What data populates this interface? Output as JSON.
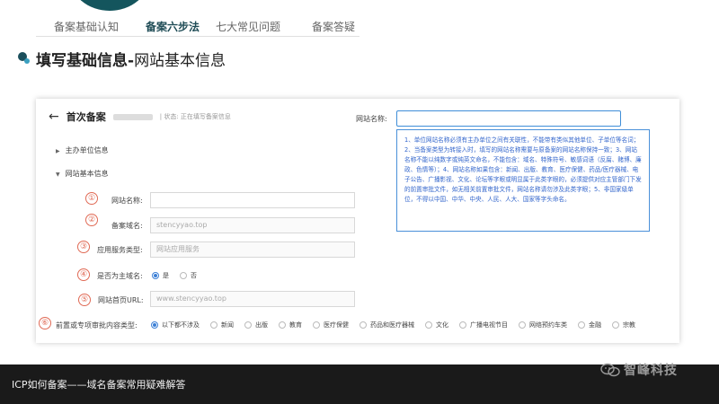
{
  "nav": {
    "items": [
      {
        "label": "备案基础认知"
      },
      {
        "label": "备案六步法"
      },
      {
        "label": "七大常见问题"
      },
      {
        "label": "备案答疑"
      }
    ]
  },
  "section": {
    "title_bold": "填写基础信息-",
    "title_rest": "网站基本信息"
  },
  "panel": {
    "back_icon": "back-arrow-icon",
    "title": "首次备案",
    "state": "| 状态: 正在填写备案信息",
    "tree": {
      "item1": "主办单位信息",
      "item2": "网站基本信息"
    },
    "nums": [
      "①",
      "②",
      "③",
      "④",
      "⑤",
      "⑥"
    ],
    "fields": {
      "site_name_label": "网站名称:",
      "domain_label": "备案域名:",
      "domain_value": "stencyyao.top",
      "service_label": "应用服务类型:",
      "service_value": "网站应用服务",
      "main_domain_label": "是否为主域名:",
      "yes": "是",
      "no": "否",
      "homepage_label": "网站首页URL:",
      "homepage_value": "www.stencyyao.top",
      "approval_label": "前置或专项审批内容类型:"
    },
    "approval_options": [
      "以下都不涉及",
      "新闻",
      "出版",
      "教育",
      "医疗保健",
      "药品和医疗器械",
      "文化",
      "广播电视节目",
      "网络预约车类",
      "金融",
      "宗教"
    ],
    "right": {
      "site_name_label": "网站名称:",
      "tooltip": "1、单位网站名称必须有主办单位之间有关联性，不能带有类似其他单位、子单位等名词；2、当备案类型为转接入时，填写的网站名称需要与原备案的网站名称保持一致；3、网站名称不能以纯数字或纯英文命名，不能包含：域名、特殊符号、敏感词语（反腐、赌博、廉政、色情等）；4、网站名称如果包含：新闻、出版、教育、医疗保健、药品/医疗器械、电子公告、广播影视、文化、论坛等字眼或明显属于此类字眼的，必须提供对应主管部门下发的前置审批文件，如无相关前置审批文件，网站名称请勿涉及此类字眼；5、非国家级单位，不得以中国、中华、中央、人民、人大、国家等字头命名。"
    }
  },
  "caption": {
    "text": "ICP如何备案——域名备案常用疑难解答"
  },
  "watermark": {
    "text": "智峰科技",
    "icon": "wechat-logo-icon"
  }
}
